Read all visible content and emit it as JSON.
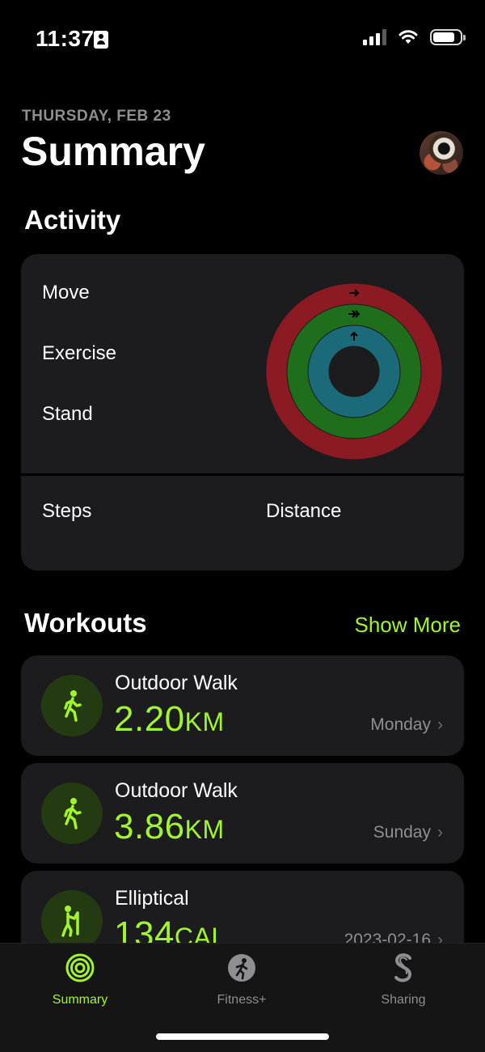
{
  "status_bar": {
    "time": "11:37"
  },
  "header": {
    "date": "THURSDAY, FEB 23",
    "title": "Summary"
  },
  "activity": {
    "title": "Activity",
    "rows": [
      "Move",
      "Exercise",
      "Stand"
    ],
    "steps_label": "Steps",
    "distance_label": "Distance"
  },
  "workouts": {
    "title": "Workouts",
    "show_more": "Show More",
    "items": [
      {
        "name": "Outdoor Walk",
        "value": "2.20",
        "unit": "KM",
        "when": "Monday",
        "icon": "walk-icon"
      },
      {
        "name": "Outdoor Walk",
        "value": "3.86",
        "unit": "KM",
        "when": "Sunday",
        "icon": "walk-icon"
      },
      {
        "name": "Elliptical",
        "value": "134",
        "unit": "CAL",
        "when": "2023-02-16",
        "icon": "elliptical-icon"
      }
    ]
  },
  "tab_bar": {
    "tabs": [
      {
        "label": "Summary",
        "icon": "activity-rings-icon",
        "active": true
      },
      {
        "label": "Fitness+",
        "icon": "fitness-plus-icon",
        "active": false
      },
      {
        "label": "Sharing",
        "icon": "sharing-icon",
        "active": false
      }
    ]
  },
  "colors": {
    "accent": "#a3f52b",
    "move": "#8b1a22",
    "exercise": "#1f6e1c",
    "stand": "#1b6a7a"
  }
}
